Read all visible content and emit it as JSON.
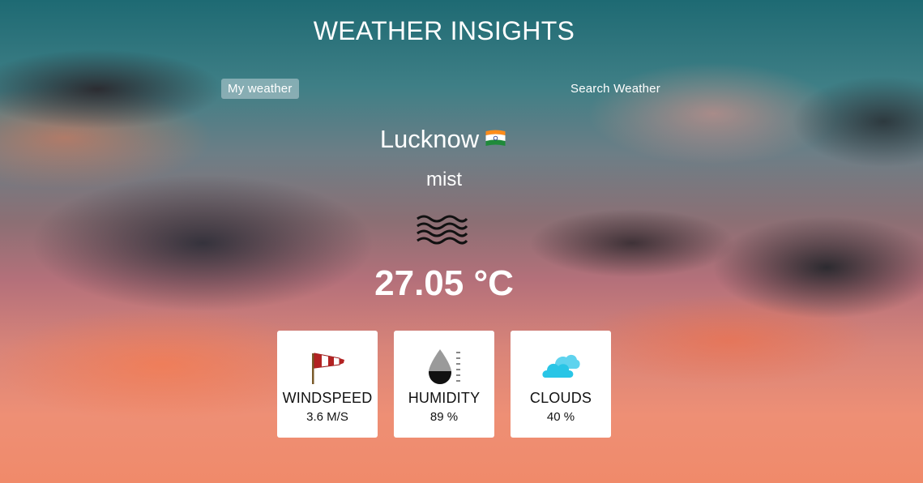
{
  "header": {
    "title": "WEATHER INSIGHTS"
  },
  "nav": {
    "my_weather": "My weather",
    "search_weather": "Search Weather"
  },
  "current": {
    "city": "Lucknow",
    "country_flag": "india-flag-icon",
    "description": "mist",
    "condition_icon": "mist-icon",
    "temperature": "27.05 °C"
  },
  "stats": {
    "wind": {
      "label": "WINDSPEED",
      "value": "3.6 M/S",
      "icon": "windsock-icon"
    },
    "humidity": {
      "label": "HUMIDITY",
      "value": "89 %",
      "icon": "humidity-icon"
    },
    "clouds": {
      "label": "CLOUDS",
      "value": "40 %",
      "icon": "cloud-icon"
    }
  },
  "colors": {
    "text": "#ffffff",
    "card_bg": "#ffffff",
    "cloud_icon": "#29c5e6",
    "windsock": "#b22222"
  }
}
